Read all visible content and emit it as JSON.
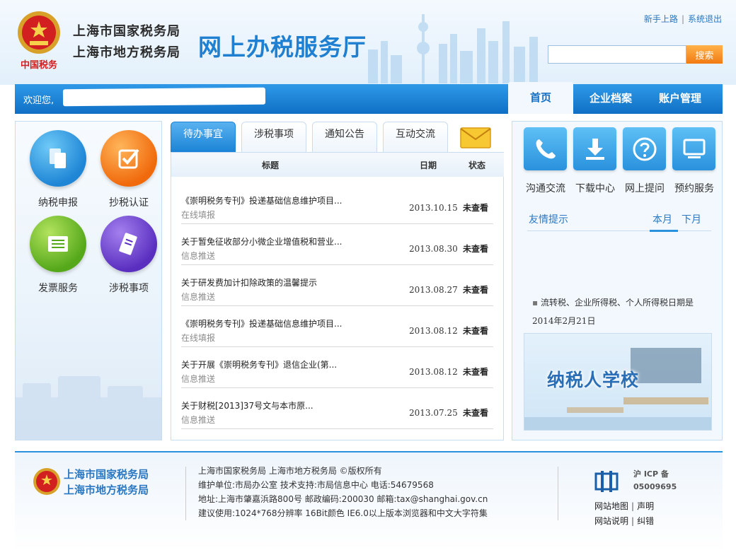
{
  "header": {
    "emblem_caption": "中国税务",
    "org_names": [
      "上海市国家税务局",
      "上海市地方税务局"
    ],
    "hall_title": "网上办税服务厅",
    "top_links": [
      "新手上路",
      "系统退出"
    ],
    "search": {
      "placeholder": "",
      "button": "搜索"
    }
  },
  "navbar": {
    "welcome": "欢迎您,",
    "tabs": [
      "首页",
      "企业档案",
      "账户管理"
    ],
    "active_tab": "首页"
  },
  "left_menu": [
    "纳税申报",
    "抄税认证",
    "发票服务",
    "涉税事项"
  ],
  "main": {
    "tabs": [
      "待办事宜",
      "涉税事项",
      "通知公告",
      "互动交流"
    ],
    "active_tab": "待办事宜",
    "columns": {
      "title": "标题",
      "date": "日期",
      "status": "状态"
    },
    "rows": [
      {
        "title": "《崇明税务专刊》投递基础信息维护项目...",
        "sub": "在线填报",
        "date": "2013.10.15",
        "status": "未查看"
      },
      {
        "title": "关于暂免征收部分小微企业增值税和营业...",
        "sub": "信息推送",
        "date": "2013.08.30",
        "status": "未查看"
      },
      {
        "title": "关于研发费加计扣除政策的温馨提示",
        "sub": "信息推送",
        "date": "2013.08.27",
        "status": "未查看"
      },
      {
        "title": "《崇明税务专刊》投递基础信息维护项目...",
        "sub": "在线填报",
        "date": "2013.08.12",
        "status": "未查看"
      },
      {
        "title": "关于开展《崇明税务专刊》退信企业(第...",
        "sub": "信息推送",
        "date": "2013.08.12",
        "status": "未查看"
      },
      {
        "title": "关于财税[2013]37号文与本市原...",
        "sub": "信息推送",
        "date": "2013.07.25",
        "status": "未查看"
      }
    ]
  },
  "right": {
    "services": [
      "沟通交流",
      "下载中心",
      "网上提问",
      "预约服务"
    ],
    "tips_title": "友情提示",
    "month_tabs": [
      "本月",
      "下月"
    ],
    "active_month": "本月",
    "tip": "流转税、企业所得税、个人所得税日期是",
    "tip_date": "2014年2月21日",
    "banner": "纳税人学校"
  },
  "footer": {
    "org_names": [
      "上海市国家税务局",
      "上海市地方税务局"
    ],
    "info_lines": [
      "上海市国家税务局 上海市地方税务局 ©版权所有",
      "维护单位:市局办公室 技术支持:市局信息中心 电话:54679568",
      "地址:上海市肇嘉浜路800号 邮政编码:200030 邮箱:tax@shanghai.gov.cn",
      "建议使用:1024*768分辨率 16Bit颜色 IE6.0以上版本浏览器和中文大字符集"
    ],
    "icp": [
      "沪 ICP 备",
      "05009695"
    ],
    "links": [
      "网站地图",
      "声明",
      "网站说明",
      "纠错"
    ]
  },
  "colors": {
    "primary_blue": "#1f7fd0",
    "nav_blue": "#0f6fc4",
    "search_orange": "#f27a12"
  }
}
